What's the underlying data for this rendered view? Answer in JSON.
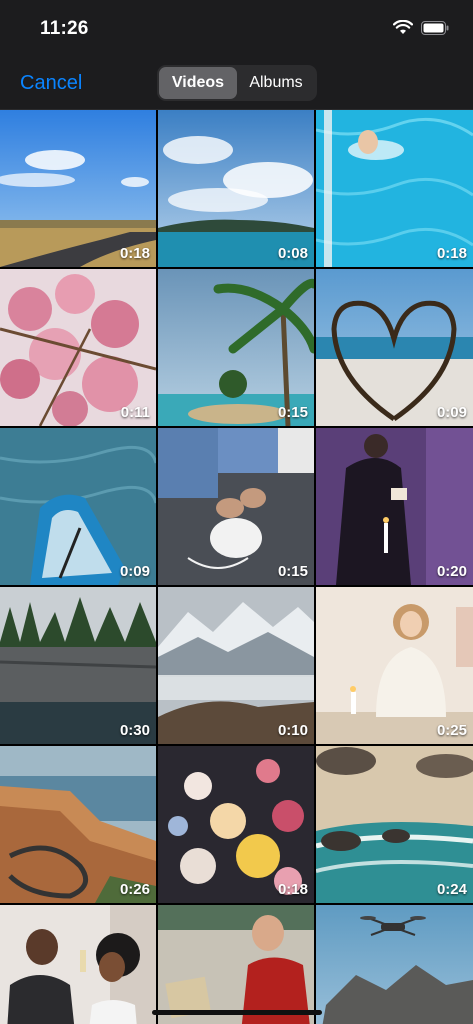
{
  "status_bar": {
    "time": "11:26"
  },
  "nav": {
    "cancel_label": "Cancel",
    "segments": [
      {
        "label": "Videos",
        "selected": true
      },
      {
        "label": "Albums",
        "selected": false
      }
    ]
  },
  "colors": {
    "accent": "#0a84ff",
    "background": "#1c1c1e"
  },
  "videos": [
    {
      "name": "road-under-blue-sky",
      "duration": "0:18"
    },
    {
      "name": "island-with-clouds",
      "duration": "0:08"
    },
    {
      "name": "swimmer-in-pool",
      "duration": "0:18"
    },
    {
      "name": "pink-blossoms",
      "duration": "0:11"
    },
    {
      "name": "palm-beach",
      "duration": "0:15"
    },
    {
      "name": "heart-shaped-driftwood",
      "duration": "0:09"
    },
    {
      "name": "paddle-board-on-water",
      "duration": "0:09"
    },
    {
      "name": "tying-sneakers",
      "duration": "0:15"
    },
    {
      "name": "man-reading-book",
      "duration": "0:20"
    },
    {
      "name": "cliffs-and-forest",
      "duration": "0:30"
    },
    {
      "name": "snowy-mountains",
      "duration": "0:10"
    },
    {
      "name": "woman-with-candle",
      "duration": "0:25"
    },
    {
      "name": "coastal-road",
      "duration": "0:26"
    },
    {
      "name": "flower-arrangement",
      "duration": "0:18"
    },
    {
      "name": "rocky-shore-waves",
      "duration": "0:24"
    },
    {
      "name": "couple-toasting",
      "duration": ""
    },
    {
      "name": "man-with-map",
      "duration": ""
    },
    {
      "name": "drone-over-mountain",
      "duration": ""
    }
  ]
}
